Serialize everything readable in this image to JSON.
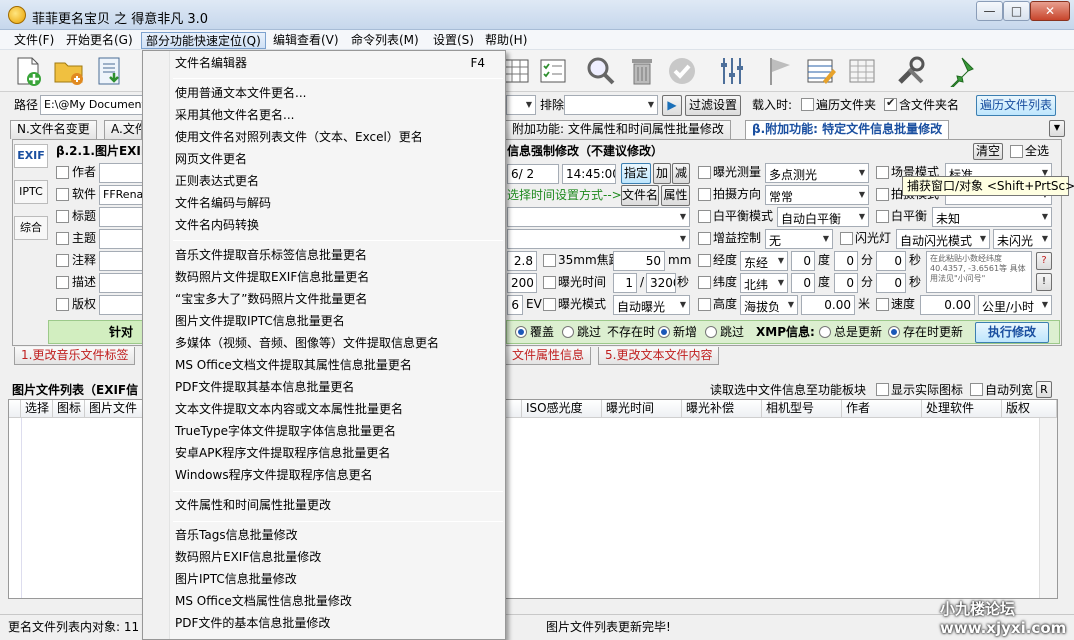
{
  "window": {
    "title": "菲菲更名宝贝 之 得意非凡 3.0"
  },
  "menubar": {
    "items": [
      "文件(F)",
      "开始更名(G)",
      "部分功能快速定位(Q)",
      "编辑查看(V)",
      "命令列表(M)",
      "设置(S)",
      "帮助(H)"
    ]
  },
  "toolbar": {
    "icons": [
      "new-file-icon",
      "open-folder-icon",
      "import-icon",
      "table-icon",
      "checklist-icon",
      "search-icon",
      "delete-icon",
      "check-icon",
      "sliders-icon",
      "flag-icon",
      "edit-table-icon",
      "grid-icon",
      "tools-icon",
      "pin-icon"
    ]
  },
  "pathrow": {
    "path_label": "路径",
    "path_value": "E:\\@My Documents\\",
    "exclude_label": "排除",
    "filter_button": "过滤设置",
    "load_label": "载入时:",
    "traverse_label": "遍历文件夹",
    "include_label": "含文件夹名",
    "traverse_button": "遍历文件列表"
  },
  "tabs": [
    "N.文件名变更",
    "A.文件",
    "附加功能: 文件属性和时间属性批量修改",
    "β.附加功能: 特定文件信息批量修改"
  ],
  "panel": {
    "side_tabs": [
      "EXIF",
      "IPTC",
      "综合"
    ],
    "section_title": "β.2.1.图片EXIF",
    "section_title2": "信息强制修改（不建议修改）",
    "clear_button": "清空",
    "select_all_label": "全选",
    "left_fields": [
      "作者",
      "软件",
      "标题",
      "主题",
      "注释",
      "描述",
      "版权"
    ],
    "software_value": "FFRena",
    "date_value": "6/ 2",
    "time_value": "14:45:00",
    "specify_button": "指定",
    "add_button": "加",
    "sub_button": "减",
    "hint_text": "选择时间设置方式-->",
    "filename_button": "文件名",
    "attr_button": "属性",
    "aperture": "2.8",
    "focal35_label": "35mm焦距",
    "focal_value": "50",
    "focal_unit": "mm",
    "iso": "200",
    "exposure_time_label": "曝光时间",
    "exp_num": "1",
    "exp_den": "3200",
    "sec_label": "秒",
    "ev": "6",
    "ev_unit": "EV",
    "exposure_mode_label": "曝光模式",
    "exposure_mode_value": "自动曝光",
    "metering_label": "曝光测量",
    "metering_value": "多点测光",
    "shoot_dir_label": "拍摄方向",
    "shoot_dir_value": "常常",
    "wb_mode_label": "白平衡模式",
    "wb_mode_value": "自动白平衡",
    "gain_label": "增益控制",
    "gain_value": "无",
    "flash_label": "闪光灯",
    "flash_value": "自动闪光模式",
    "flash_value2": "未闪光",
    "lon_label": "经度",
    "lon_dir": "东经",
    "lat_label": "纬度",
    "lat_dir": "北纬",
    "deg": "度",
    "min": "分",
    "sec": "秒",
    "zero": "0",
    "alt_label": "高度",
    "alt_value": "海拔负",
    "alt_num": "0.00",
    "alt_unit": "米",
    "speed_label": "速度",
    "speed_num": "0.00",
    "speed_unit": "公里/小时",
    "scene_label": "场景模式",
    "scene_value": "标准",
    "shoot_label": "拍摄模式",
    "wb_label": "白平衡",
    "wb_value": "未知",
    "coord_hint": "在此粘贴小数经纬度 40.4357, -3.6561等 具体用法见\"小问号\"",
    "green_bar_text": "针对",
    "overwrite_label": "覆盖",
    "skip_label": "跳过",
    "missing_label": "不存在时",
    "add_new_label": "新增",
    "skip2_label": "跳过",
    "xmp_label": "XMP信息:",
    "always_update_label": "总是更新",
    "update_if_exists_label": "存在时更新",
    "execute_button": "执行修改"
  },
  "bottom_tabs": [
    "1.更改音乐文件标签",
    "文件属性信息",
    "5.更改文本文件内容"
  ],
  "list": {
    "title": "图片文件列表（EXIF信",
    "read_label": "读取选中文件信息至功能板块",
    "show_icon_label": "显示实际图标",
    "auto_width_label": "自动列宽",
    "r_button": "R",
    "columns": [
      "选择",
      "图标",
      "图片文件",
      "ISO感光度",
      "曝光时间",
      "曝光补偿",
      "相机型号",
      "作者",
      "处理软件",
      "版权"
    ]
  },
  "status": {
    "left": "更名文件列表内对象: 11",
    "middle": "图片文件列表更新完毕!"
  },
  "dropdown": {
    "items": [
      {
        "label": "文件名编辑器",
        "shortcut": "F4"
      },
      {
        "label": "使用普通文本文件更名..."
      },
      {
        "label": "采用其他文件名更名..."
      },
      {
        "label": "使用文件名对照列表文件（文本、Excel）更名"
      },
      {
        "label": "网页文件更名"
      },
      {
        "label": "正则表达式更名"
      },
      {
        "label": "文件名编码与解码"
      },
      {
        "label": "文件名内码转换"
      },
      {
        "label": "音乐文件提取音乐标签信息批量更名"
      },
      {
        "label": "数码照片文件提取EXIF信息批量更名"
      },
      {
        "label": "“宝宝多大了”数码照片文件批量更名"
      },
      {
        "label": "图片文件提取IPTC信息批量更名"
      },
      {
        "label": "多媒体（视频、音频、图像等）文件提取信息更名"
      },
      {
        "label": "MS Office文档文件提取其属性信息批量更名"
      },
      {
        "label": "PDF文件提取其基本信息批量更名"
      },
      {
        "label": "文本文件提取文本内容或文本属性批量更名"
      },
      {
        "label": "TrueType字体文件提取字体信息批量更名"
      },
      {
        "label": "安卓APK程序文件提取程序信息批量更名"
      },
      {
        "label": "Windows程序文件提取程序信息更名"
      },
      {
        "label": "文件属性和时间属性批量更改"
      },
      {
        "label": "音乐Tags信息批量修改"
      },
      {
        "label": "数码照片EXIF信息批量修改"
      },
      {
        "label": "图片IPTC信息批量修改"
      },
      {
        "label": "MS Office文档属性信息批量修改"
      },
      {
        "label": "PDF文件的基本信息批量修改"
      }
    ]
  },
  "tooltip": "捕获窗口/对象 <Shift+PrtSc>",
  "watermark": "小九楼论坛 www.xjyxi.com"
}
